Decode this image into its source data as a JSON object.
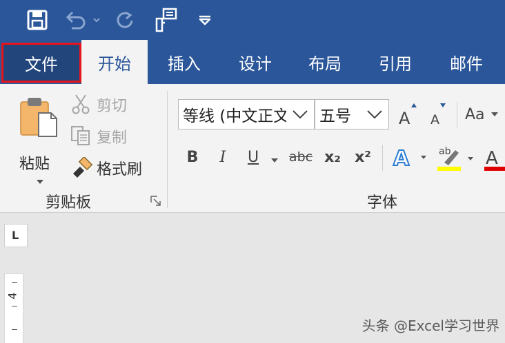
{
  "qat": {
    "save": "save-icon",
    "undo": "undo-icon",
    "redo": "redo-icon",
    "touch": "touch-mode-icon",
    "customize": "customize-icon"
  },
  "tabs": [
    {
      "label": "文件"
    },
    {
      "label": "开始"
    },
    {
      "label": "插入"
    },
    {
      "label": "设计"
    },
    {
      "label": "布局"
    },
    {
      "label": "引用"
    },
    {
      "label": "邮件"
    }
  ],
  "clipboard": {
    "paste": "粘贴",
    "cut": "剪切",
    "copy": "复制",
    "format_painter": "格式刷",
    "group_label": "剪贴板"
  },
  "font": {
    "font_name": "等线 (中文正文)",
    "font_size": "五号",
    "change_case": "Aa",
    "bold": "B",
    "italic": "I",
    "underline": "U",
    "strikethrough": "abc",
    "subscript": "x₂",
    "superscript": "x²",
    "group_label": "字体"
  },
  "ruler": {
    "tab_selector": "L",
    "vertical_number": "4"
  },
  "watermark": "头条 @Excel学习世界",
  "colors": {
    "accent": "#2b579a",
    "file_outline": "#e8141c",
    "highlight": "#ffff00",
    "font_color": "#e00000"
  }
}
